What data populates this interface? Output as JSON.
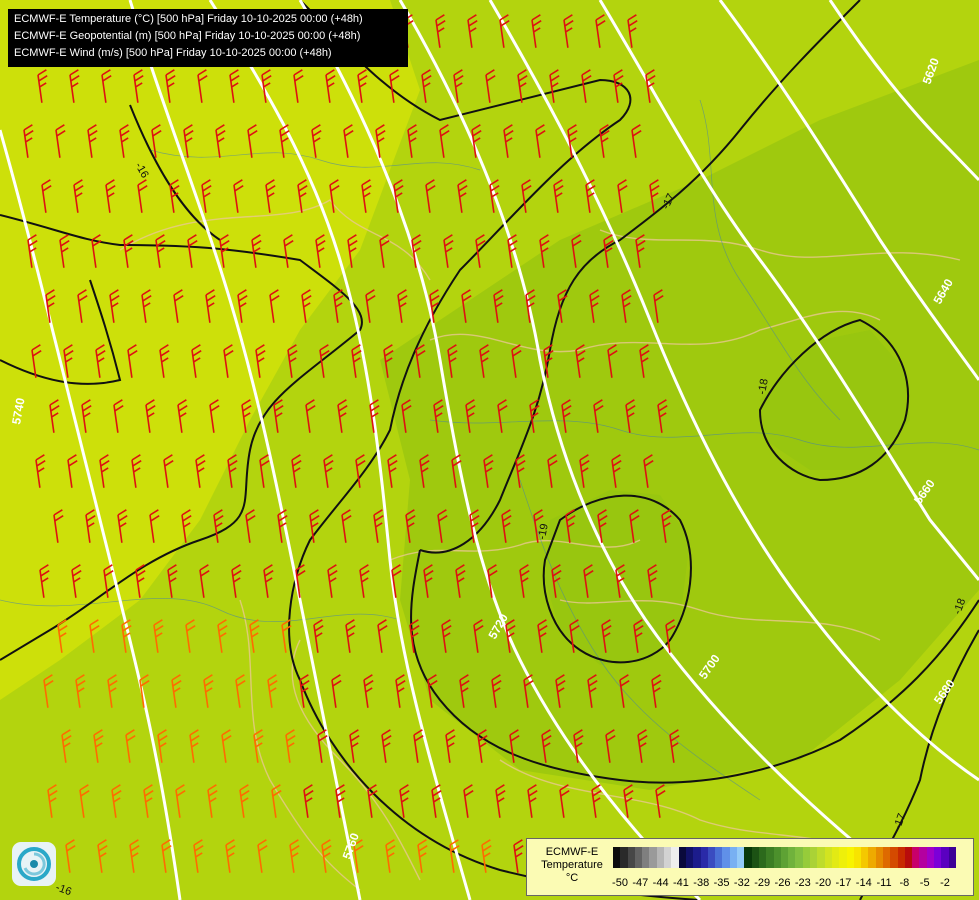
{
  "header": {
    "lines": [
      "ECMWF-E Temperature (°C) [500 hPa] Friday 10-10-2025 00:00 (+48h)",
      "ECMWF-E Geopotential (m) [500 hPa] Friday 10-10-2025 00:00 (+48h)",
      "ECMWF-E Wind (m/s) [500 hPa] Friday 10-10-2025 00:00 (+48h)"
    ]
  },
  "map": {
    "fill_colors": {
      "warm": "#cde00a",
      "mid": "#b3d40e",
      "cold": "#98c60f"
    },
    "geopotential_labels": [
      "5620",
      "5640",
      "5660",
      "5680",
      "5700",
      "5720",
      "5740",
      "5760"
    ],
    "temperature_labels": [
      "-16",
      "-17",
      "-18",
      "-19",
      "-18",
      "-17",
      "-16"
    ],
    "contour_colors": {
      "geopotential": "#ffffff",
      "temperature": "#111111",
      "wind": "#dd1111",
      "wind_light": "#ff6a00"
    },
    "logo_icon": "swirl-logo-icon"
  },
  "legend": {
    "title_lines": [
      "ECMWF-E",
      "Temperature",
      "°C"
    ],
    "ticks": [
      "-50",
      "-47",
      "-44",
      "-41",
      "-38",
      "-35",
      "-32",
      "-29",
      "-26",
      "-23",
      "-20",
      "-17",
      "-14",
      "-11",
      "-8",
      "-5",
      "-2"
    ],
    "colors": [
      "#0d0d0d",
      "#2a2a2a",
      "#474747",
      "#636363",
      "#7f7f7f",
      "#9a9a9a",
      "#b6b6b6",
      "#d2d2d2",
      "#eeeeee",
      "#0a0a3c",
      "#12126a",
      "#1c1c8c",
      "#2a2aa8",
      "#3a4cc0",
      "#4a70d6",
      "#6090e8",
      "#78b0f2",
      "#94cbf8",
      "#0a3a0a",
      "#1c5214",
      "#2c6a1c",
      "#3c7e24",
      "#4c902c",
      "#5ea234",
      "#70b23c",
      "#82c040",
      "#96cc3a",
      "#aad236",
      "#bedc2c",
      "#d2e420",
      "#e2ea14",
      "#eef00a",
      "#f8f400",
      "#f8e400",
      "#f4c800",
      "#eeaa00",
      "#e68a00",
      "#de6a00",
      "#d44a00",
      "#c82a00",
      "#b80c0c",
      "#c8006a",
      "#b400a0",
      "#a000c8",
      "#7c00d8",
      "#5a00c0",
      "#3c0096"
    ]
  }
}
